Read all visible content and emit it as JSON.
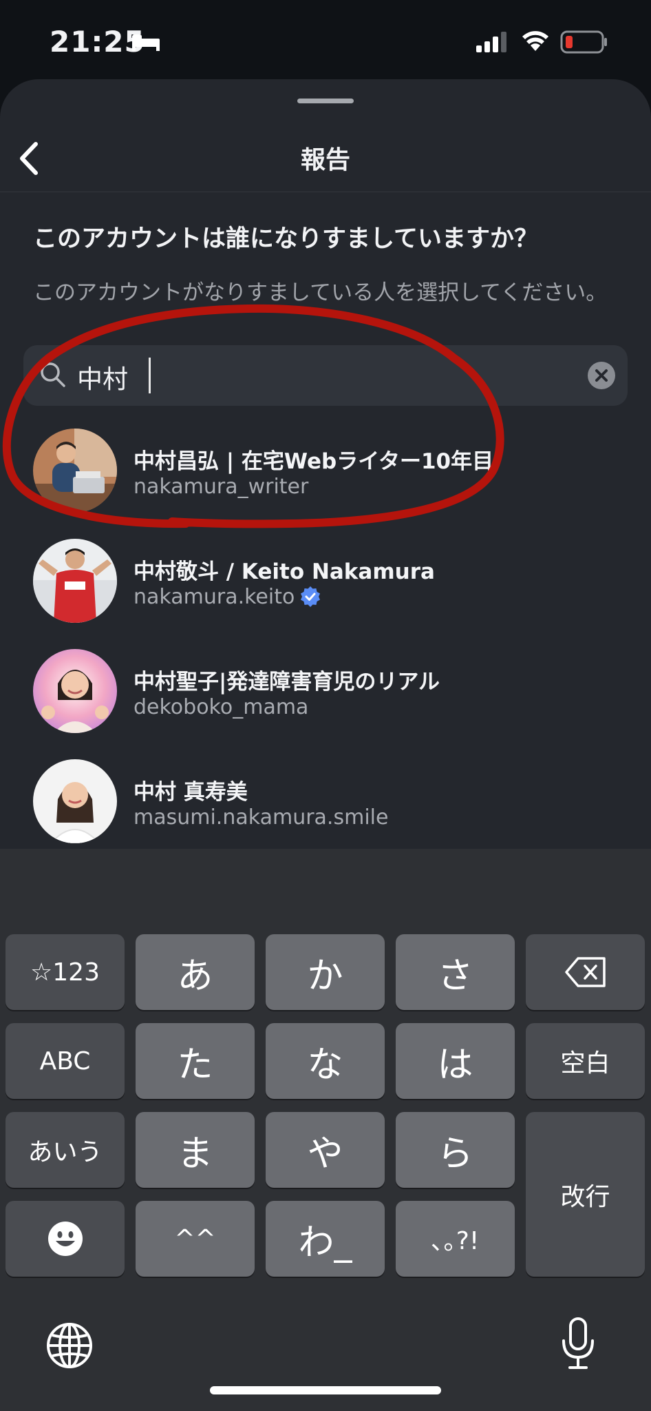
{
  "status": {
    "time": "21:25"
  },
  "header": {
    "title": "報告"
  },
  "prompt": {
    "question": "このアカウントは誰になりすましていますか？",
    "subtext": "このアカウントがなりすましている人を選択してください。"
  },
  "search": {
    "value": "中村"
  },
  "results": [
    {
      "name": "中村昌弘 | 在宅Webライター10年目",
      "handle": "nakamura_writer",
      "verified": false
    },
    {
      "name": "中村敬斗 / Keito Nakamura",
      "handle": "nakamura.keito",
      "verified": true
    },
    {
      "name": "中村聖子|発達障害育児のリアル",
      "handle": "dekoboko_mama",
      "verified": false
    },
    {
      "name": "中村 真寿美",
      "handle": "masumi.nakamura.smile",
      "verified": false
    }
  ],
  "keyboard": {
    "row1": [
      "☆123",
      "あ",
      "か",
      "さ"
    ],
    "row2": [
      "ABC",
      "た",
      "な",
      "は",
      "空白"
    ],
    "row3": [
      "あいう",
      "ま",
      "や",
      "ら"
    ],
    "row4": [
      "^^",
      "わ_",
      "､｡?!"
    ],
    "return_label": "改行"
  },
  "colors": {
    "annotation": "#b5140c",
    "verified": "#5a8df6",
    "battery_low": "#e5382e"
  }
}
